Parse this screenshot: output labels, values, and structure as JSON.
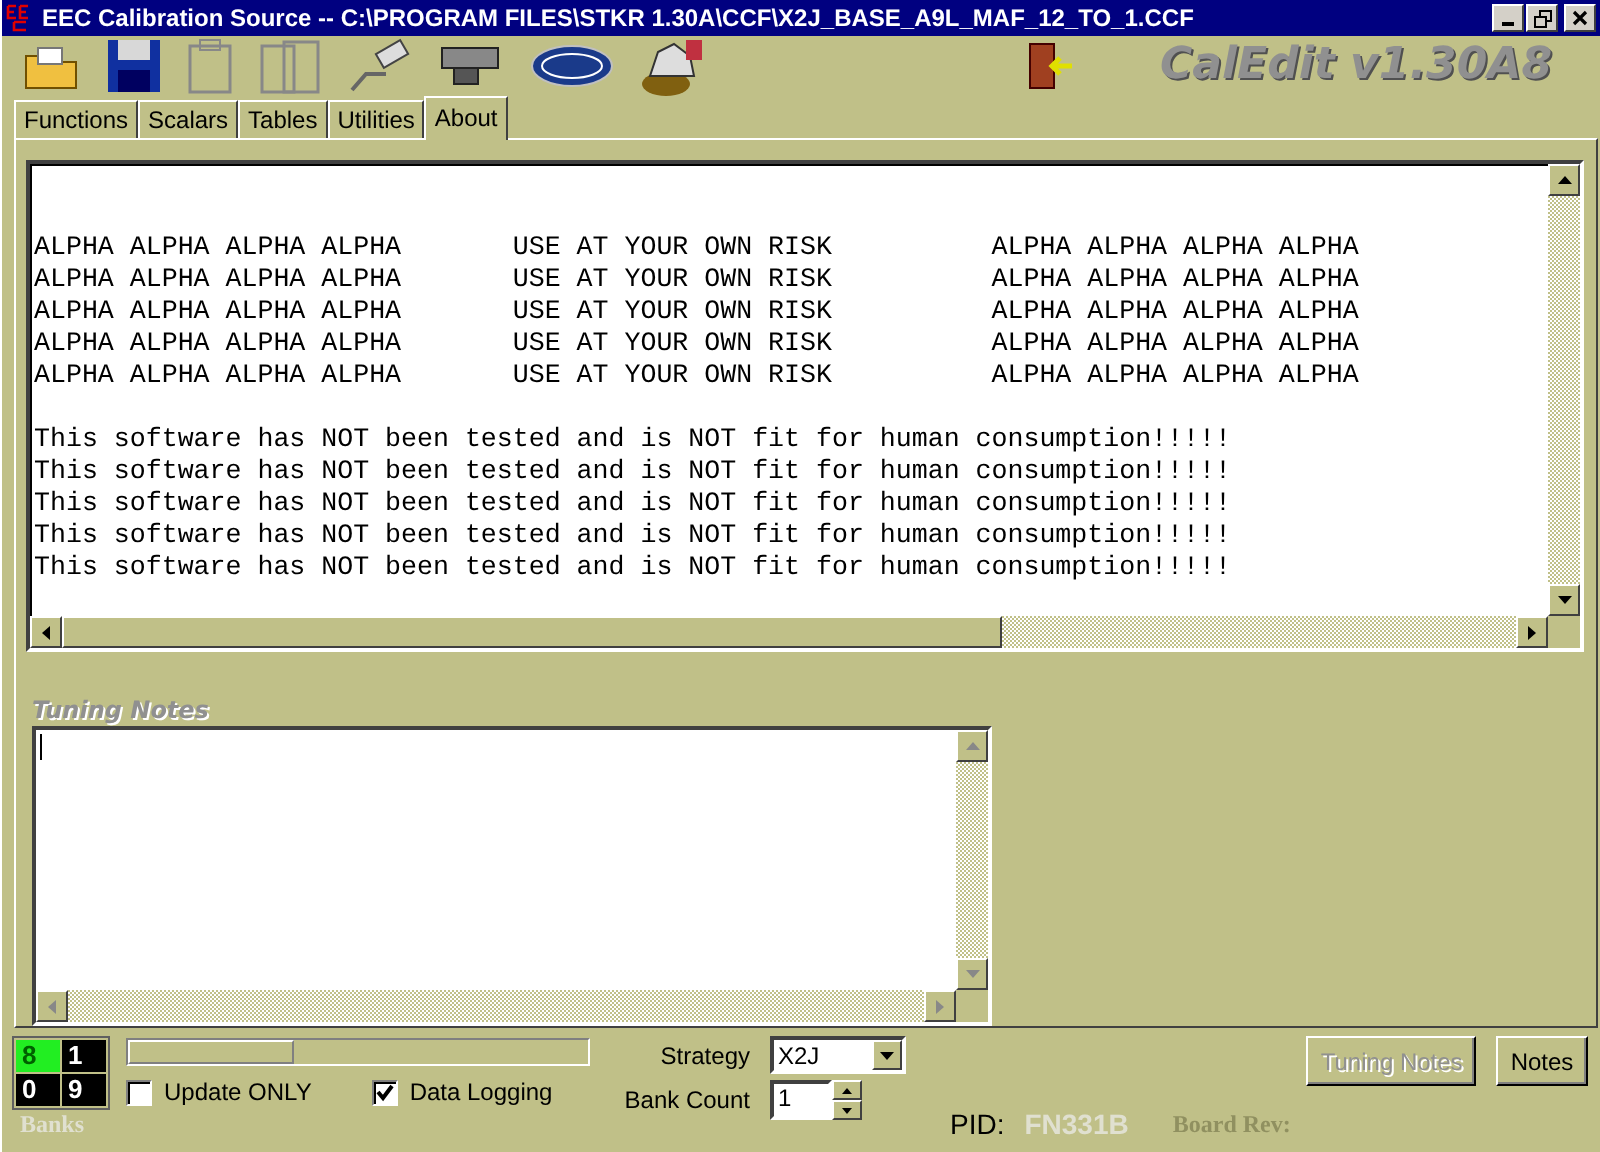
{
  "window": {
    "title": "EEC Calibration Source -- C:\\PROGRAM FILES\\STKR 1.30A\\CCF\\X2J_BASE_A9L_MAF_12_TO_1.CCF"
  },
  "logo": "CalEdit v1.30A8",
  "tabs": [
    {
      "label": "Functions",
      "selected": false
    },
    {
      "label": "Scalars",
      "selected": false
    },
    {
      "label": "Tables",
      "selected": false
    },
    {
      "label": "Utilities",
      "selected": false
    },
    {
      "label": "About",
      "selected": true
    }
  ],
  "about_lines": [
    "ALPHA ALPHA ALPHA ALPHA       USE AT YOUR OWN RISK          ALPHA ALPHA ALPHA ALPHA",
    "ALPHA ALPHA ALPHA ALPHA       USE AT YOUR OWN RISK          ALPHA ALPHA ALPHA ALPHA",
    "ALPHA ALPHA ALPHA ALPHA       USE AT YOUR OWN RISK          ALPHA ALPHA ALPHA ALPHA",
    "ALPHA ALPHA ALPHA ALPHA       USE AT YOUR OWN RISK          ALPHA ALPHA ALPHA ALPHA",
    "ALPHA ALPHA ALPHA ALPHA       USE AT YOUR OWN RISK          ALPHA ALPHA ALPHA ALPHA"
  ],
  "warning_lines": [
    "This software has NOT been tested and is NOT fit for human consumption!!!!!",
    "This software has NOT been tested and is NOT fit for human consumption!!!!!",
    "This software has NOT been tested and is NOT fit for human consumption!!!!!",
    "This software has NOT been tested and is NOT fit for human consumption!!!!!",
    "This software has NOT been tested and is NOT fit for human consumption!!!!!"
  ],
  "tuning_notes": {
    "label": "Tuning Notes"
  },
  "banks": {
    "label": "Banks",
    "cells": [
      {
        "label": "8",
        "selected": true
      },
      {
        "label": "1",
        "selected": false
      },
      {
        "label": "0",
        "selected": false
      },
      {
        "label": "9",
        "selected": false
      }
    ]
  },
  "progress": {
    "level": 0.36
  },
  "checkboxes": [
    {
      "label": "Update ONLY",
      "checked": false
    },
    {
      "label": "Data Logging",
      "checked": true
    }
  ],
  "strategy": {
    "label": "Strategy",
    "value": "X2J"
  },
  "bank_count": {
    "label": "Bank Count",
    "value": "1"
  },
  "pid": {
    "label": "PID:",
    "value": "FN331B"
  },
  "board_rev": {
    "label": "Board Rev:"
  },
  "buttons": [
    {
      "label": "Tuning Notes",
      "disabled": true
    },
    {
      "label": "Notes",
      "disabled": false
    }
  ]
}
